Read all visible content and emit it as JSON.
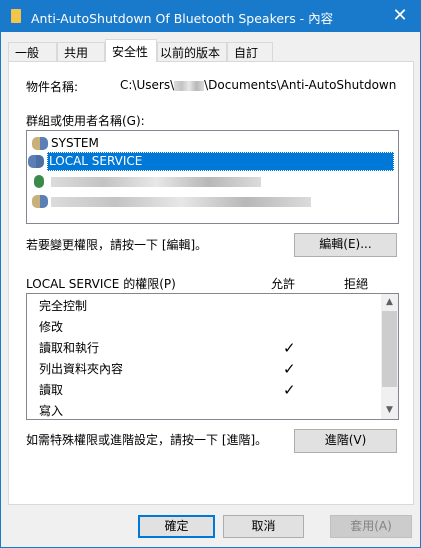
{
  "window": {
    "title": "Anti-AutoShutdown Of Bluetooth Speakers - 內容",
    "close_icon": "close-icon",
    "folder_icon": "folder-icon"
  },
  "tabs": [
    {
      "label": "一般"
    },
    {
      "label": "共用"
    },
    {
      "label": "安全性",
      "active": true
    },
    {
      "label": "以前的版本"
    },
    {
      "label": "自訂"
    }
  ],
  "security": {
    "object_label": "物件名稱:",
    "object_path_prefix": "C:\\Users\\",
    "object_path_suffix": "\\Documents\\Anti-AutoShutdown O",
    "groups_label": "群組或使用者名稱(G):",
    "groups": [
      {
        "name": "SYSTEM"
      },
      {
        "name": "LOCAL SERVICE",
        "selected": true
      },
      {
        "name": "",
        "blurred": true
      },
      {
        "name": "",
        "blurred": true
      }
    ],
    "edit_hint": "若要變更權限，請按一下 [編輯]。",
    "edit_button": "編輯(E)...",
    "perm_header": "LOCAL SERVICE 的權限(P)",
    "allow_header": "允許",
    "deny_header": "拒絕",
    "permissions": [
      {
        "name": "完全控制",
        "allow": false,
        "deny": false
      },
      {
        "name": "修改",
        "allow": false,
        "deny": false
      },
      {
        "name": "讀取和執行",
        "allow": true,
        "deny": false
      },
      {
        "name": "列出資料夾內容",
        "allow": true,
        "deny": false
      },
      {
        "name": "讀取",
        "allow": true,
        "deny": false
      },
      {
        "name": "寫入",
        "allow": false,
        "deny": false
      }
    ],
    "check_glyph": "✓",
    "advanced_hint": "如需特殊權限或進階設定，請按一下 [進階]。",
    "advanced_button": "進階(V)"
  },
  "footer": {
    "ok": "確定",
    "cancel": "取消",
    "apply": "套用(A)"
  }
}
